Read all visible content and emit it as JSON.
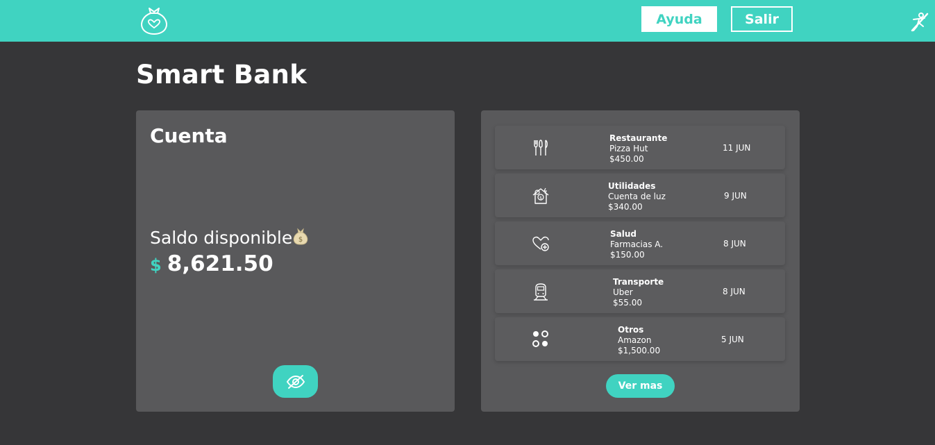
{
  "header": {
    "logo_icon": "money-bag-smile-icon",
    "help_label": "Ayuda",
    "exit_label": "Salir",
    "accessibility_icon": "accessibility-toggle-icon",
    "accent_color": "#40d3c1"
  },
  "page": {
    "title": "Smart Bank"
  },
  "account": {
    "title": "Cuenta",
    "balance_label": "Saldo disponible",
    "currency_symbol": "$",
    "balance_amount": "8,621.50",
    "toggle_icon": "eye-slash-icon"
  },
  "transactions": {
    "items": [
      {
        "icon": "restaurant-cutlery-icon",
        "category": "Restaurante",
        "merchant": "Pizza Hut",
        "amount": "$450.00",
        "date": "11 JUN"
      },
      {
        "icon": "house-utilities-icon",
        "category": "Utilidades",
        "merchant": "Cuenta de luz",
        "amount": "$340.00",
        "date": "9 JUN"
      },
      {
        "icon": "health-heart-icon",
        "category": "Salud",
        "merchant": "Farmacias A.",
        "amount": "$150.00",
        "date": "8 JUN"
      },
      {
        "icon": "train-transport-icon",
        "category": "Transporte",
        "merchant": "Uber",
        "amount": "$55.00",
        "date": "8 JUN"
      },
      {
        "icon": "grid-dots-icon",
        "category": "Otros",
        "merchant": "Amazon",
        "amount": "$1,500.00",
        "date": "5 JUN"
      }
    ],
    "more_label": "Ver mas"
  }
}
